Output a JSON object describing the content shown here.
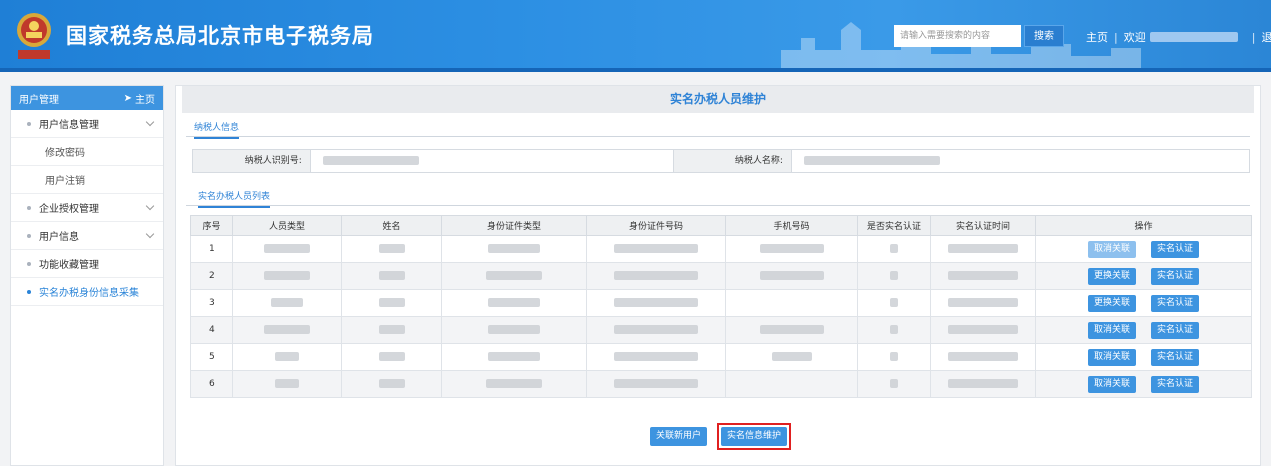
{
  "header": {
    "title": "国家税务总局北京市电子税务局",
    "search_placeholder": "请输入需要搜索的内容",
    "search_button": "搜索",
    "home_link": "主页",
    "welcome": "欢迎",
    "logout_link": "退出",
    "emblem_icon": "tax-emblem-icon"
  },
  "sidebar": {
    "header_label": "用户管理",
    "home_label": "主页",
    "items": [
      {
        "label": "用户信息管理",
        "type": "group"
      },
      {
        "label": "修改密码",
        "type": "sub"
      },
      {
        "label": "用户注销",
        "type": "sub"
      },
      {
        "label": "企业授权管理",
        "type": "group"
      },
      {
        "label": "用户信息",
        "type": "group"
      },
      {
        "label": "功能收藏管理",
        "type": "group"
      },
      {
        "label": "实名办税身份信息采集",
        "type": "active"
      }
    ]
  },
  "main": {
    "page_title": "实名办税人员维护",
    "taxpayer_tab": "纳税人信息",
    "taxpayer_id_label": "纳税人识别号:",
    "taxpayer_name_label": "纳税人名称:",
    "list_tab": "实名办税人员列表",
    "table": {
      "headers": [
        "序号",
        "人员类型",
        "姓名",
        "身份证件类型",
        "身份证件号码",
        "手机号码",
        "是否实名认证",
        "实名认证时间",
        "操作"
      ],
      "rows": [
        {
          "seq": "1",
          "action1": "取消关联",
          "action1_disabled": true,
          "action2": "实名认证"
        },
        {
          "seq": "2",
          "action1": "更换关联",
          "action1_disabled": false,
          "action2": "实名认证"
        },
        {
          "seq": "3",
          "action1": "更换关联",
          "action1_disabled": false,
          "action2": "实名认证"
        },
        {
          "seq": "4",
          "action1": "取消关联",
          "action1_disabled": false,
          "action2": "实名认证"
        },
        {
          "seq": "5",
          "action1": "取消关联",
          "action1_disabled": false,
          "action2": "实名认证"
        },
        {
          "seq": "6",
          "action1": "取消关联",
          "action1_disabled": false,
          "action2": "实名认证"
        }
      ]
    },
    "buttons": {
      "link_new_user": "关联新用户",
      "realname_maintain": "实名信息维护"
    }
  },
  "colors": {
    "header_blue": "#2c8fe3",
    "accent": "#3d94e0",
    "highlight_border": "#e02020"
  }
}
